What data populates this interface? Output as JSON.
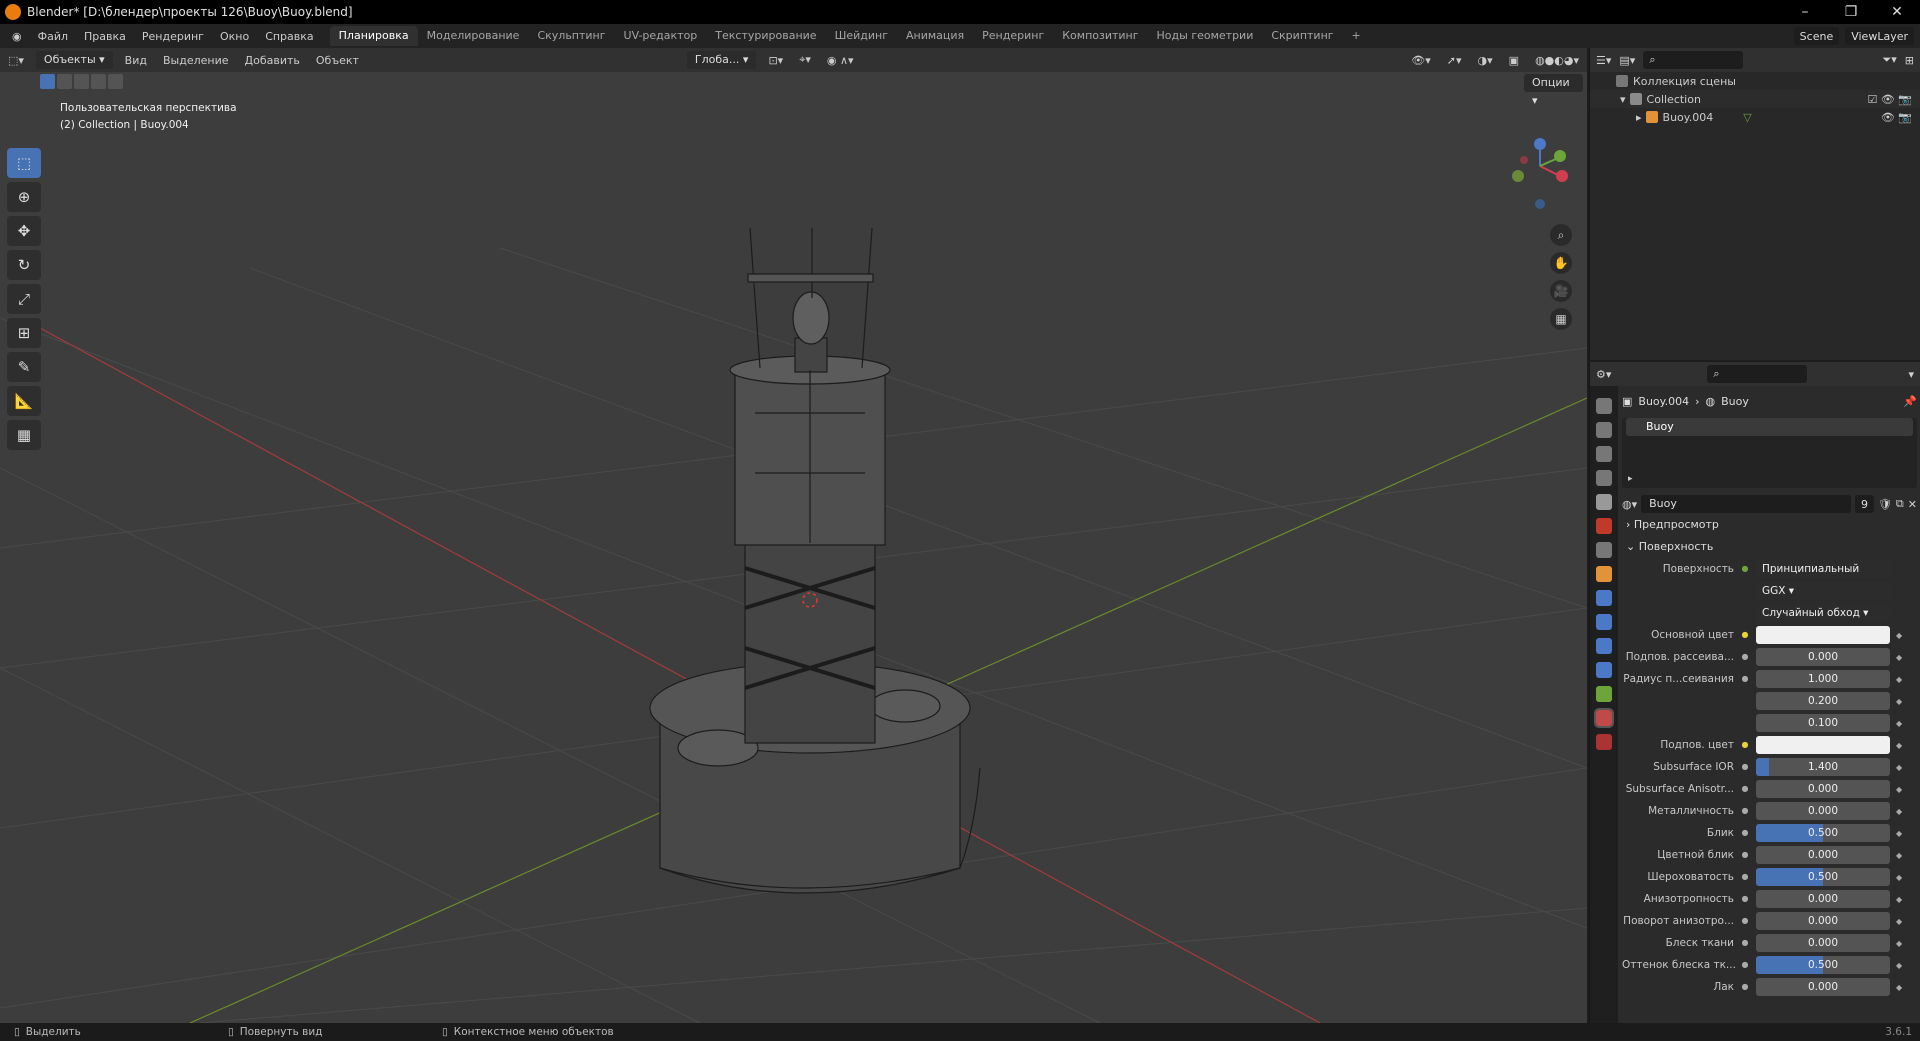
{
  "window": {
    "title": "Blender* [D:\\блендер\\проекты 126\\Buoy\\Buoy.blend]"
  },
  "menu": [
    "Файл",
    "Правка",
    "Рендеринг",
    "Окно",
    "Справка"
  ],
  "workspaces": [
    "Планировка",
    "Моделирование",
    "Скульптинг",
    "UV-редактор",
    "Текстурирование",
    "Шейдинг",
    "Анимация",
    "Рендеринг",
    "Композитинг",
    "Ноды геометрии",
    "Скриптинг",
    "+"
  ],
  "active_workspace": "Планировка",
  "scene": "Scene",
  "view_layer": "ViewLayer",
  "viewport": {
    "mode": "Объекты",
    "menus": [
      "Вид",
      "Выделение",
      "Добавить",
      "Объект"
    ],
    "transform_orientation": "Глоба...",
    "options": "Опции",
    "overlay_line1": "Пользовательская перспектива",
    "overlay_line2": "(2) Collection | Buoy.004"
  },
  "outliner": {
    "root": "Коллекция сцены",
    "collection": "Collection",
    "object": "Buoy.004"
  },
  "properties": {
    "breadcrumb_object": "Buoy.004",
    "breadcrumb_material": "Buoy",
    "slot": "Buoy",
    "material_name": "Buoy",
    "users": "9",
    "section_preview": "Предпросмотр",
    "section_surface": "Поверхность",
    "surface_label": "Поверхность",
    "surface_value": "Принципиальный BSDF",
    "distribution": "GGX",
    "subsurface_method": "Случайный обход",
    "rows": [
      {
        "label": "Основной цвет",
        "type": "color"
      },
      {
        "label": "Подпов. рассеива...",
        "value": "0.000"
      },
      {
        "label": "Радиус п...сеивания",
        "value": "1.000"
      },
      {
        "label": "",
        "value": "0.200"
      },
      {
        "label": "",
        "value": "0.100"
      },
      {
        "label": "Подпов. цвет",
        "type": "color"
      },
      {
        "label": "Subsurface IOR",
        "value": "1.400",
        "fill": 0.1
      },
      {
        "label": "Subsurface Anisotr...",
        "value": "0.000"
      },
      {
        "label": "Металличность",
        "value": "0.000"
      },
      {
        "label": "Блик",
        "value": "0.500",
        "fill": 0.5
      },
      {
        "label": "Цветной блик",
        "value": "0.000"
      },
      {
        "label": "Шероховатость",
        "value": "0.500",
        "fill": 0.5
      },
      {
        "label": "Анизотропность",
        "value": "0.000"
      },
      {
        "label": "Поворот анизотро...",
        "value": "0.000"
      },
      {
        "label": "Блеск ткани",
        "value": "0.000"
      },
      {
        "label": "Оттенок блеска тк...",
        "value": "0.500",
        "fill": 0.5
      },
      {
        "label": "Лак",
        "value": "0.000"
      }
    ]
  },
  "status": {
    "select": "Выделить",
    "rotate": "Повернуть вид",
    "context": "Контекстное меню объектов",
    "version": "3.6.1"
  }
}
